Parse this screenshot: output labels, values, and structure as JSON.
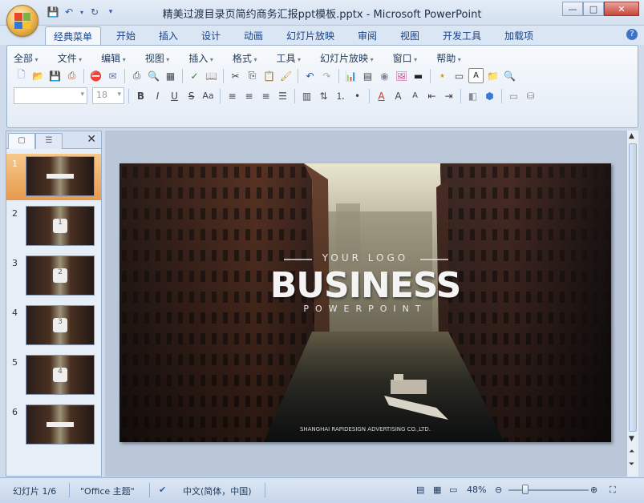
{
  "window": {
    "title": "精美过渡目录页简约商务汇报ppt模板.pptx - Microsoft PowerPoint",
    "controls": [
      "—",
      "□",
      "✕"
    ]
  },
  "tabs": [
    "经典菜单",
    "开始",
    "插入",
    "设计",
    "动画",
    "幻灯片放映",
    "审阅",
    "视图",
    "开发工具",
    "加载项"
  ],
  "menus": [
    "全部",
    "文件",
    "编辑",
    "视图",
    "插入",
    "格式",
    "工具",
    "幻灯片放映",
    "窗口",
    "帮助"
  ],
  "format": {
    "font_size": "18"
  },
  "slides": {
    "count": 6,
    "selected": 1,
    "items": [
      {
        "num": "1",
        "mark": ""
      },
      {
        "num": "2",
        "mark": "1"
      },
      {
        "num": "3",
        "mark": "2"
      },
      {
        "num": "4",
        "mark": "3"
      },
      {
        "num": "5",
        "mark": "4"
      },
      {
        "num": "6",
        "mark": ""
      }
    ]
  },
  "slide": {
    "logo": "YOUR LOGO",
    "heading": "BUSINESS",
    "subheading": "POWERPOINT",
    "footer": "SHANGHAI RAPIDESIGN ADVERTISING CO.,LTD."
  },
  "status": {
    "slide_indicator": "幻灯片 1/6",
    "theme": "\"Office 主题\"",
    "language": "中文(简体，中国)",
    "zoom": "48%"
  },
  "colors": {
    "accent": "#e79a4c",
    "ribbon_text": "#15428b"
  }
}
